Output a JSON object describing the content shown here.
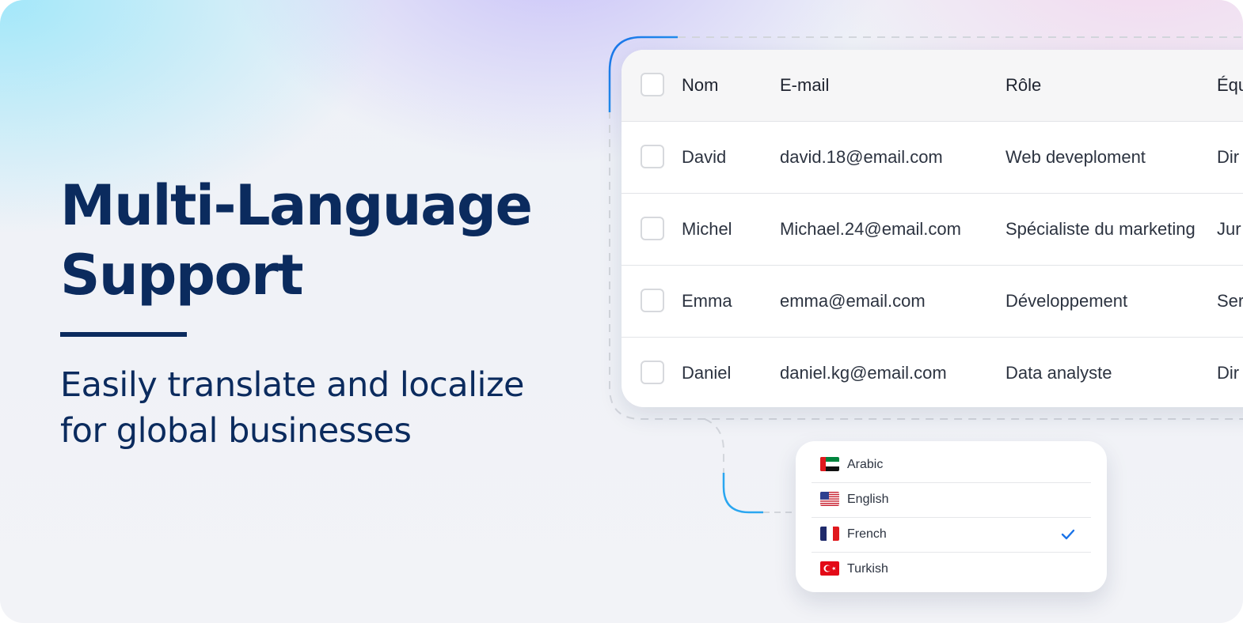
{
  "hero": {
    "title": "Multi-Language Support",
    "subtitle": "Easily translate and localize for global businesses"
  },
  "table": {
    "headers": [
      "Nom",
      "E-mail",
      "Rôle",
      "Équ"
    ],
    "rows": [
      [
        "David",
        "david.18@email.com",
        "Web deveploment",
        "Dir"
      ],
      [
        "Michel",
        "Michael.24@email.com",
        "Spécialiste du marketing",
        "Jur"
      ],
      [
        "Emma",
        "emma@email.com",
        "Développement",
        "Ser"
      ],
      [
        "Daniel",
        "daniel.kg@email.com",
        "Data analyste",
        "Dir"
      ]
    ]
  },
  "languages": {
    "items": [
      {
        "label": "Arabic",
        "flag": "uae-flag-icon",
        "selected": false
      },
      {
        "label": "English",
        "flag": "us-flag-icon",
        "selected": false
      },
      {
        "label": "French",
        "flag": "france-flag-icon",
        "selected": true
      },
      {
        "label": "Turkish",
        "flag": "turkey-flag-icon",
        "selected": false
      }
    ],
    "check_icon": "checkmark-icon"
  },
  "colors": {
    "headline": "#0b2b5e",
    "accent": "#1a73e8",
    "text": "#2c3340",
    "divider": "#e2e4e8"
  }
}
